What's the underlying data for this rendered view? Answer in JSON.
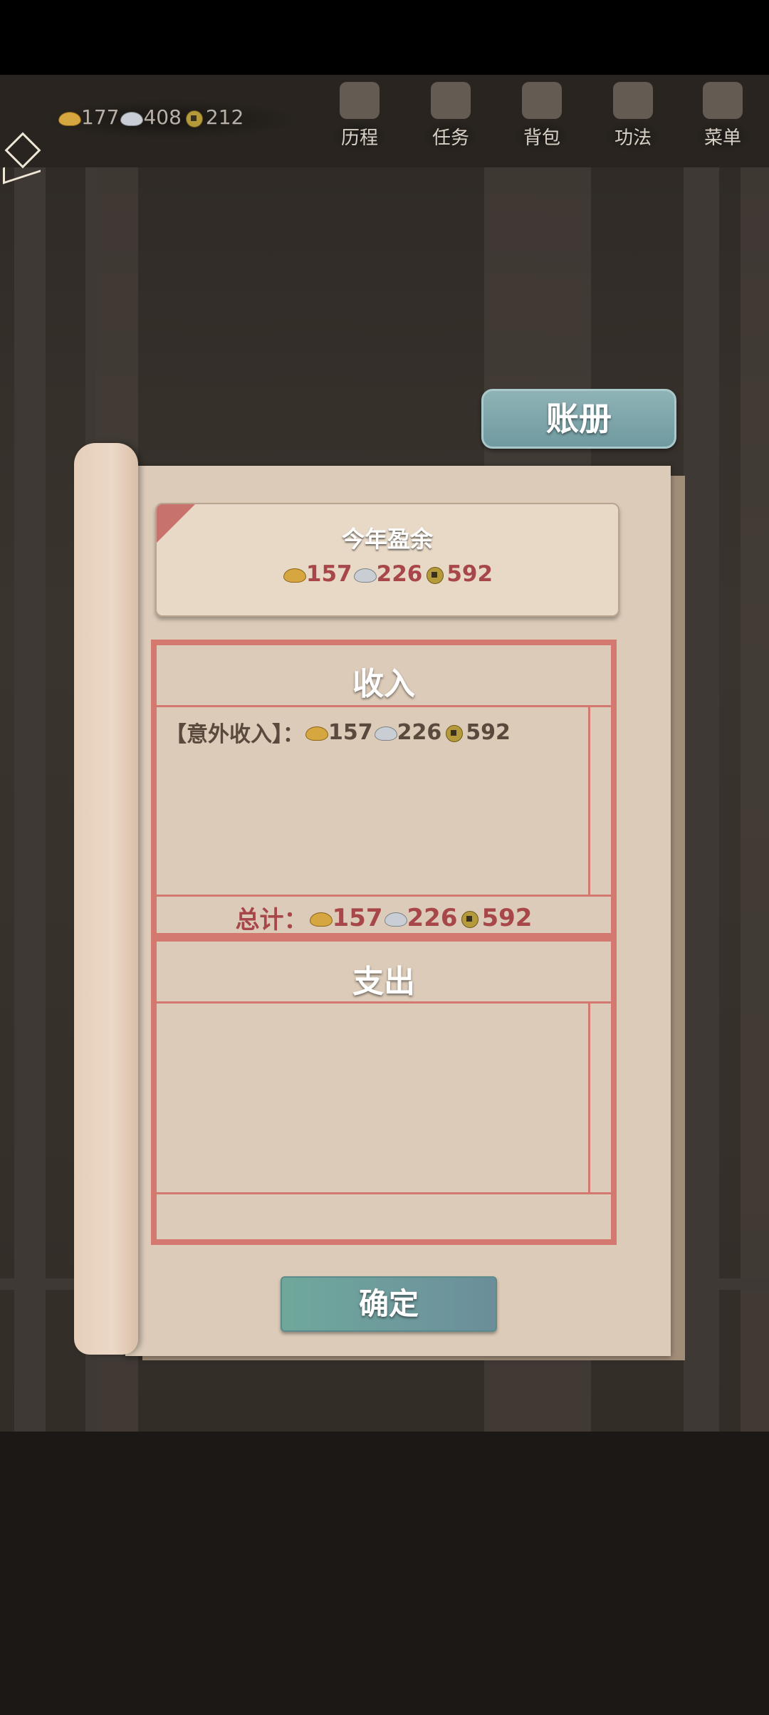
{
  "hud": {
    "currencies": [
      {
        "icon": "gold-ingot-icon",
        "value": "177"
      },
      {
        "icon": "silver-ingot-icon",
        "value": "408"
      },
      {
        "icon": "copper-coin-icon",
        "value": "212"
      }
    ],
    "nav": [
      {
        "key": "history",
        "label": "历程",
        "icon": "scroll-sage-icon"
      },
      {
        "key": "tasks",
        "label": "任务",
        "icon": "bundle-icon"
      },
      {
        "key": "bag",
        "label": "背包",
        "icon": "pouch-icon"
      },
      {
        "key": "skills",
        "label": "功法",
        "icon": "book-icon"
      },
      {
        "key": "menu",
        "label": "菜单",
        "icon": "fan-icon"
      }
    ]
  },
  "ledger": {
    "title": "账册",
    "surplus": {
      "title": "今年盈余",
      "gold": "157",
      "silver": "226",
      "copper": "592"
    },
    "income": {
      "title": "收入",
      "entries": [
        {
          "label": "【意外收入】：",
          "gold": "157",
          "silver": "226",
          "copper": "592"
        }
      ],
      "total_label": "总计：",
      "total": {
        "gold": "157",
        "silver": "226",
        "copper": "592"
      }
    },
    "expense": {
      "title": "支出"
    },
    "confirm_label": "确定"
  },
  "colors": {
    "accent_red": "#d4796f",
    "amount_red": "#a7474a",
    "button_teal": "#6e9a9c"
  }
}
